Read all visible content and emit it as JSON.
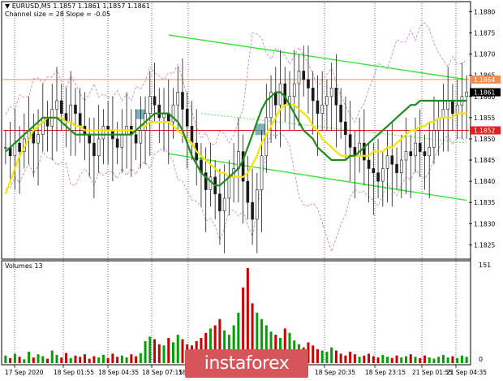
{
  "header": {
    "symbol_line": "EURUSD,M5  1.1857 1.1861 1.1857 1.1861",
    "indicator_line": "Channel size = 28 Slope = -0.05"
  },
  "volume_panel": {
    "label": "Volumes 13",
    "axis_top": "151",
    "axis_bottom": "0"
  },
  "watermark": {
    "text": "instaforex"
  },
  "colors": {
    "bull_candle": "#1a1a1a",
    "bear_candle": "#1a1a1a",
    "ma_fast": "#1f8c1f",
    "ma_slow": "#f5e400",
    "bollinger": "#c878c8",
    "channel": "#33e633",
    "level_resistance": "#f28c52",
    "level_support": "#e31e24",
    "highlight_box": "#5a9ba8",
    "volume_up": "#00a000",
    "volume_down": "#c80000"
  },
  "chart_data": {
    "type": "candlestick",
    "y_ticks": [
      "1.1880",
      "1.1875",
      "1.1870",
      "1.1865",
      "1.1860",
      "1.1855",
      "1.1850",
      "1.1845",
      "1.1840",
      "1.1835",
      "1.1830",
      "1.1825"
    ],
    "ylim": [
      1.1822,
      1.1882
    ],
    "x_ticks": [
      "17 Sep 2020",
      "18 Sep 01:55",
      "18 Sep 04:35",
      "18 Sep 07:15",
      "18 Sep 09:55",
      "18 Sep 20:35",
      "18 Sep 23:15",
      "21 Sep 01:55",
      "21 Sep 04:35"
    ],
    "price_labels": [
      {
        "value": 1.1864,
        "text": "1.1864",
        "bg": "#f28c52"
      },
      {
        "value": 1.1861,
        "text": "1.1861",
        "bg": "#000000"
      },
      {
        "value": 1.1852,
        "text": "1.1852",
        "bg": "#e31e24"
      }
    ],
    "horizontal_levels": [
      {
        "value": 1.1864,
        "color": "#f28c52"
      },
      {
        "value": 1.1852,
        "color": "#e31e24"
      }
    ],
    "channel": {
      "upper": [
        [
          35,
          1.18745
        ],
        [
          100,
          1.1864
        ]
      ],
      "lower": [
        [
          35,
          1.18465
        ],
        [
          100,
          1.18355
        ]
      ],
      "mid": [
        [
          42,
          1.1856
        ],
        [
          100,
          1.1849
        ]
      ]
    },
    "close": [
      1.1848,
      1.1846,
      1.1849,
      1.1847,
      1.185,
      1.1852,
      1.1849,
      1.1851,
      1.1855,
      1.1853,
      1.1857,
      1.1859,
      1.1856,
      1.1854,
      1.1858,
      1.1856,
      1.1853,
      1.1851,
      1.1849,
      1.1846,
      1.185,
      1.1853,
      1.1852,
      1.185,
      1.1848,
      1.1851,
      1.1853,
      1.1851,
      1.1849,
      1.1852,
      1.1856,
      1.186,
      1.1858,
      1.1855,
      1.1856,
      1.1854,
      1.1858,
      1.1861,
      1.1857,
      1.1853,
      1.1849,
      1.1845,
      1.1842,
      1.1838,
      1.1841,
      1.1837,
      1.1833,
      1.1836,
      1.1841,
      1.1843,
      1.1847,
      1.184,
      1.1835,
      1.1831,
      1.1838,
      1.1846,
      1.1855,
      1.1861,
      1.1858,
      1.1863,
      1.1858,
      1.186,
      1.1863,
      1.1866,
      1.1864,
      1.1862,
      1.1859,
      1.1856,
      1.1858,
      1.186,
      1.1862,
      1.1858,
      1.1854,
      1.1851,
      1.1848,
      1.1846,
      1.1849,
      1.1845,
      1.1843,
      1.1842,
      1.184,
      1.1843,
      1.1846,
      1.1844,
      1.1842,
      1.1845,
      1.1847,
      1.1846,
      1.1849,
      1.1847,
      1.1846,
      1.1848,
      1.1852,
      1.1855,
      1.1857,
      1.1859,
      1.1856,
      1.1858,
      1.186,
      1.1861
    ],
    "ma_fast": [
      1.1847,
      1.1848,
      1.1849,
      1.185,
      1.1851,
      1.1852,
      1.1853,
      1.1854,
      1.1855,
      1.1855,
      1.1855,
      1.1855,
      1.1854,
      1.1853,
      1.1852,
      1.1851,
      1.1851,
      1.1851,
      1.1851,
      1.1851,
      1.1851,
      1.1851,
      1.1851,
      1.1851,
      1.1851,
      1.1851,
      1.1851,
      1.1851,
      1.1852,
      1.1853,
      1.1854,
      1.1855,
      1.1856,
      1.1856,
      1.1856,
      1.1856,
      1.1855,
      1.1854,
      1.1852,
      1.1849,
      1.1846,
      1.1844,
      1.1842,
      1.1841,
      1.184,
      1.1839,
      1.1839,
      1.184,
      1.1841,
      1.1842,
      1.1843,
      1.1845,
      1.1848,
      1.1851,
      1.1854,
      1.1857,
      1.1859,
      1.186,
      1.1861,
      1.1861,
      1.186,
      1.1858,
      1.1856,
      1.1854,
      1.1852,
      1.1851,
      1.185,
      1.1848,
      1.1847,
      1.1846,
      1.1845,
      1.1845,
      1.1845,
      1.1845,
      1.1846,
      1.1846,
      1.1847,
      1.1848,
      1.1849,
      1.185,
      1.1851,
      1.1852,
      1.1853,
      1.1854,
      1.1855,
      1.1856,
      1.1857,
      1.1858,
      1.1858,
      1.1859,
      1.1859,
      1.1859,
      1.1859,
      1.1859,
      1.1859,
      1.1859,
      1.1859,
      1.1859,
      1.1859,
      1.1859
    ],
    "ma_slow": [
      1.1837,
      1.184,
      1.1843,
      1.1846,
      1.1848,
      1.185,
      1.1852,
      1.1853,
      1.1854,
      1.1855,
      1.1855,
      1.1855,
      1.1855,
      1.1854,
      1.1854,
      1.1853,
      1.1853,
      1.1852,
      1.1852,
      1.1852,
      1.1852,
      1.1852,
      1.1852,
      1.1852,
      1.1852,
      1.1852,
      1.1852,
      1.1852,
      1.1852,
      1.1853,
      1.1853,
      1.1854,
      1.1854,
      1.1854,
      1.1854,
      1.1854,
      1.1853,
      1.1852,
      1.1851,
      1.185,
      1.1849,
      1.1847,
      1.1846,
      1.1845,
      1.1844,
      1.1843,
      1.1842,
      1.1842,
      1.1841,
      1.1841,
      1.1841,
      1.1841,
      1.1842,
      1.1844,
      1.1846,
      1.1849,
      1.1851,
      1.1853,
      1.1855,
      1.1857,
      1.1858,
      1.1858,
      1.1858,
      1.1857,
      1.1856,
      1.1855,
      1.1853,
      1.1852,
      1.185,
      1.1849,
      1.1848,
      1.1847,
      1.1846,
      1.1846,
      1.1846,
      1.1846,
      1.1846,
      1.1846,
      1.1846,
      1.1847,
      1.1847,
      1.1847,
      1.1848,
      1.1848,
      1.1849,
      1.185,
      1.1851,
      1.1852,
      1.1852,
      1.1853,
      1.1853,
      1.1854,
      1.1854,
      1.1855,
      1.1855,
      1.1855,
      1.1855,
      1.1856,
      1.1856,
      1.1856
    ],
    "volumes": [
      12,
      8,
      15,
      10,
      6,
      18,
      9,
      14,
      11,
      7,
      20,
      13,
      9,
      16,
      8,
      12,
      10,
      14,
      7,
      11,
      9,
      13,
      8,
      15,
      10,
      12,
      9,
      14,
      11,
      16,
      35,
      42,
      38,
      30,
      28,
      40,
      33,
      45,
      38,
      30,
      28,
      35,
      40,
      48,
      55,
      60,
      70,
      52,
      45,
      60,
      80,
      120,
      151,
      95,
      80,
      70,
      60,
      50,
      45,
      40,
      55,
      48,
      36,
      30,
      25,
      33,
      28,
      22,
      20,
      18,
      25,
      20,
      15,
      12,
      18,
      14,
      10,
      12,
      15,
      11,
      9,
      13,
      10,
      8,
      12,
      9,
      11,
      14,
      10,
      8,
      12,
      9,
      7,
      10,
      13,
      9,
      11,
      8,
      12,
      10
    ]
  }
}
